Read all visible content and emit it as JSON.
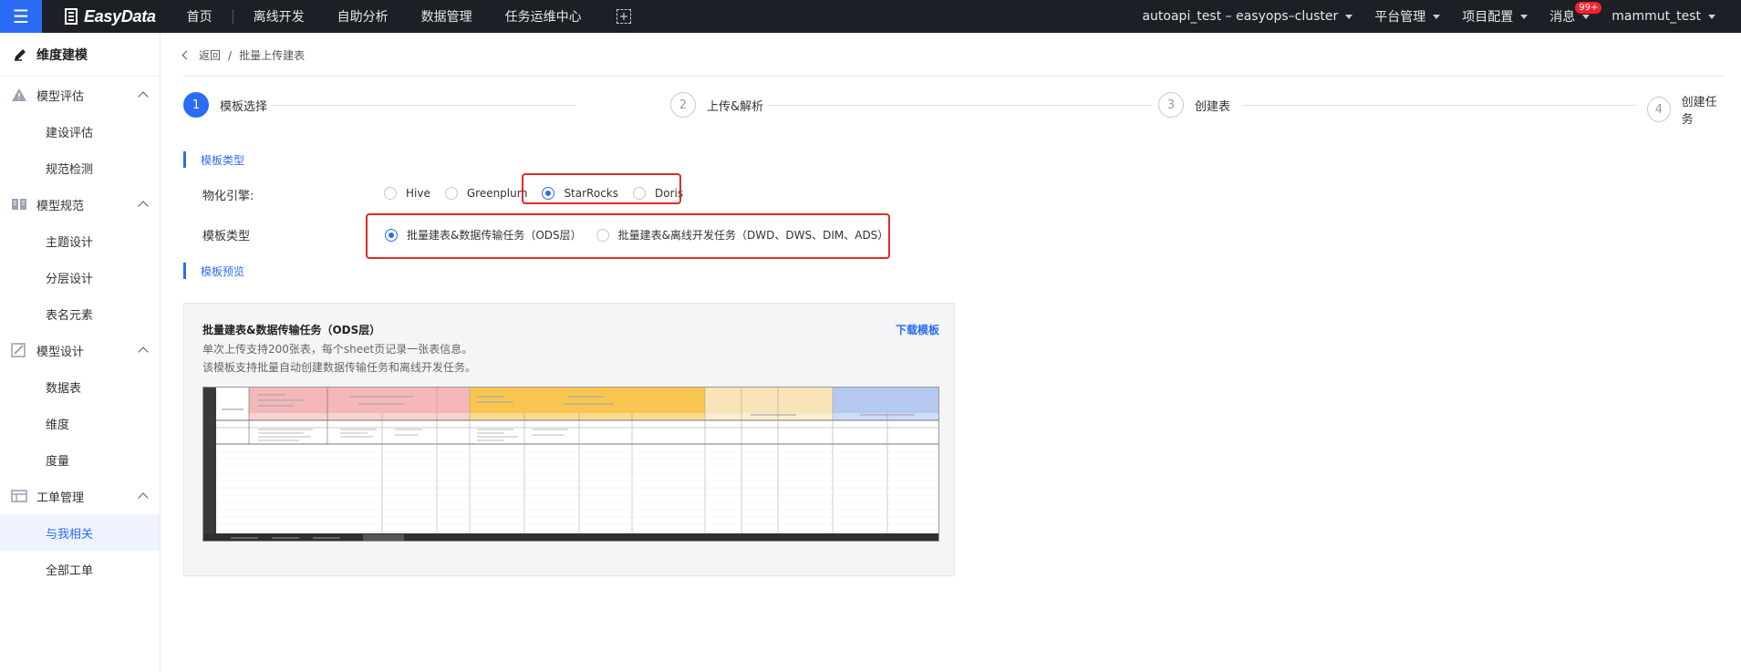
{
  "topbar": {
    "logo_text": "EasyData",
    "nav": [
      "首页",
      "离线开发",
      "自助分析",
      "数据管理",
      "任务运维中心"
    ],
    "cluster": "autoapi_test – easyops–cluster",
    "platform": "平台管理",
    "project": "项目配置",
    "messages": "消息",
    "badge": "99+",
    "user": "mammut_test"
  },
  "sidebar": {
    "title": "维度建模",
    "groups": [
      {
        "label": "模型评估",
        "items": [
          "建设评估",
          "规范检测"
        ]
      },
      {
        "label": "模型规范",
        "items": [
          "主题设计",
          "分层设计",
          "表名元素"
        ]
      },
      {
        "label": "模型设计",
        "items": [
          "数据表",
          "维度",
          "度量"
        ]
      },
      {
        "label": "工单管理",
        "items": [
          "与我相关",
          "全部工单"
        ]
      }
    ],
    "active_item": "与我相关"
  },
  "breadcrumb": {
    "back": "返回",
    "sep": "/",
    "current": "批量上传建表"
  },
  "steps": [
    {
      "num": "1",
      "label": "模板选择"
    },
    {
      "num": "2",
      "label": "上传&解析"
    },
    {
      "num": "3",
      "label": "创建表"
    },
    {
      "num": "4",
      "label": "创建任务"
    }
  ],
  "form": {
    "section_template_type": "模板类型",
    "engine_label": "物化引擎:",
    "engines": [
      "Hive",
      "Greenplum",
      "StarRocks",
      "Doris"
    ],
    "engine_selected": "StarRocks",
    "template_label": "模板类型",
    "templates": [
      "批量建表&数据传输任务（ODS层）",
      "批量建表&离线开发任务（DWD、DWS、DIM、ADS）"
    ],
    "template_selected": "批量建表&数据传输任务（ODS层）",
    "section_preview": "模板预览"
  },
  "preview": {
    "title": "批量建表&数据传输任务（ODS层）",
    "download": "下载模板",
    "desc1": "单次上传支持200张表，每个sheet页记录一张表信息。",
    "desc2": "该模板支持批量自动创建数据传输任务和离线开发任务。"
  },
  "colors": {
    "accent": "#2b6cf5",
    "topbar": "#1d1f26",
    "highlight": "#e02b2b"
  }
}
